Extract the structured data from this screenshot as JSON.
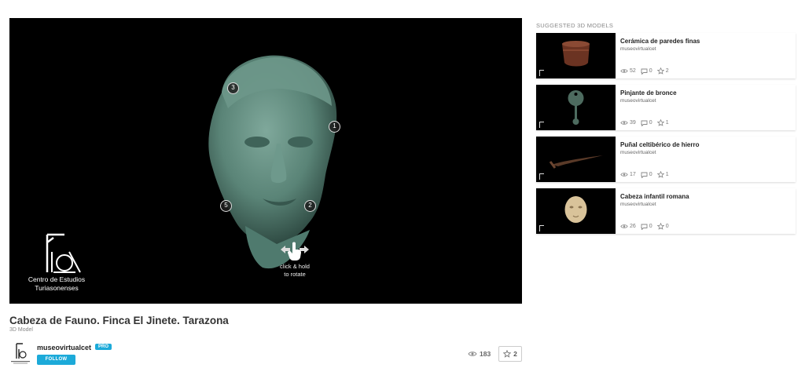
{
  "viewer": {
    "hotspots": [
      "1",
      "2",
      "3",
      "5"
    ],
    "rotate_hint_line1": "click & hold",
    "rotate_hint_line2": "to rotate",
    "logo_line1": "Centro de Estudios",
    "logo_line2": "Turiasonenses"
  },
  "model": {
    "title": "Cabeza de Fauno. Finca El Jinete. Tarazona",
    "subtitle": "3D Model",
    "author": "museovirtualcet",
    "pro_label": "PRO",
    "follow_label": "FOLLOW",
    "views": "183",
    "likes": "2"
  },
  "sidebar": {
    "title": "SUGGESTED 3D MODELS",
    "items": [
      {
        "title": "Cerámica de paredes finas",
        "author": "museovirtualcet",
        "views": "52",
        "comments": "0",
        "likes": "2"
      },
      {
        "title": "Pinjante de bronce",
        "author": "museovirtualcet",
        "views": "39",
        "comments": "0",
        "likes": "1"
      },
      {
        "title": "Puñal celtibérico de hierro",
        "author": "museovirtualcet",
        "views": "17",
        "comments": "0",
        "likes": "1"
      },
      {
        "title": "Cabeza infantil romana",
        "author": "museovirtualcet",
        "views": "26",
        "comments": "0",
        "likes": "0"
      }
    ]
  },
  "colors": {
    "accent": "#1caad9",
    "viewer_bg": "#000000",
    "head": "#5f8a7d"
  }
}
